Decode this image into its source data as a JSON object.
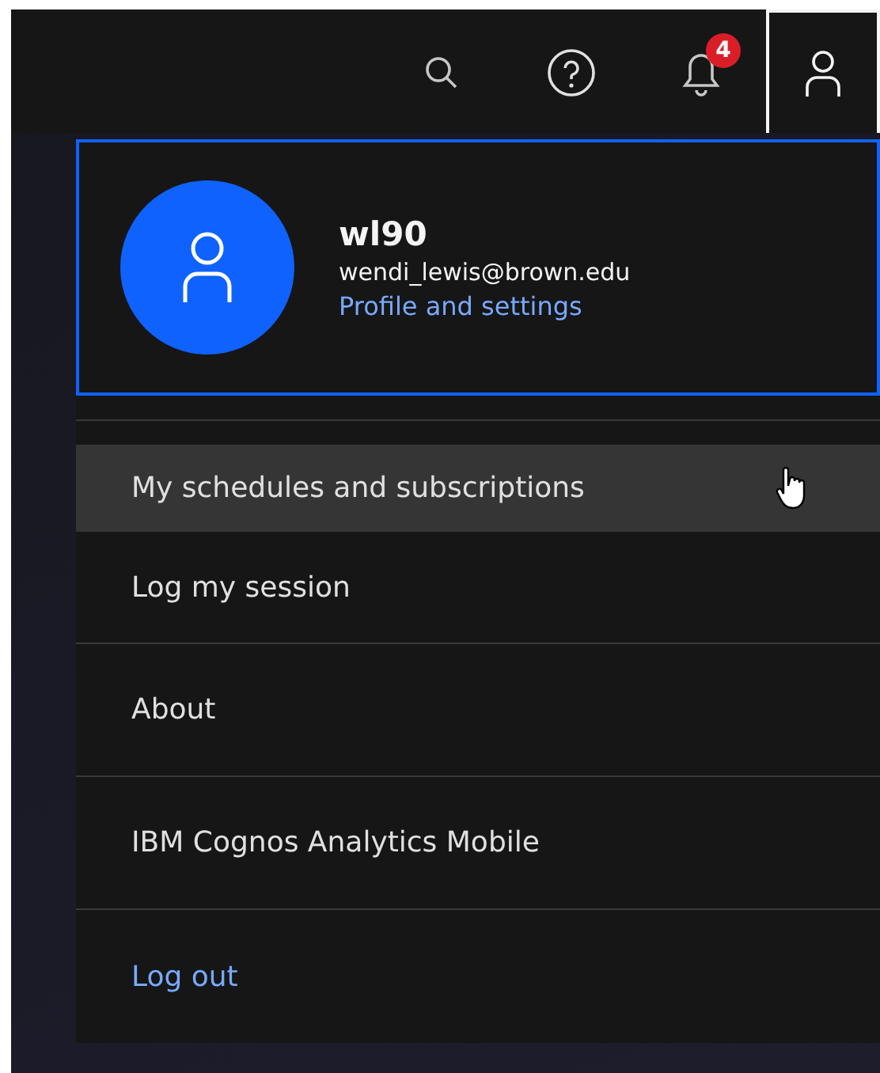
{
  "header": {
    "icons": [
      {
        "kind": "search",
        "selected": false
      },
      {
        "kind": "help",
        "selected": false
      },
      {
        "kind": "bell",
        "selected": false,
        "badge": "4"
      },
      {
        "kind": "user",
        "selected": true
      }
    ]
  },
  "profile": {
    "username": "wl90",
    "email": "wendi_lewis@brown.edu",
    "link": "Profile and settings"
  },
  "menu": [
    {
      "label": "My schedules and subscriptions",
      "kind": "item",
      "highlighted": true
    },
    {
      "label": "Log my session",
      "kind": "item",
      "highlighted": false
    },
    {
      "label": "About",
      "kind": "item",
      "highlighted": false
    },
    {
      "label": "IBM Cognos Analytics Mobile",
      "kind": "item",
      "highlighted": false
    },
    {
      "label": "Log out",
      "kind": "link",
      "highlighted": false
    }
  ]
}
